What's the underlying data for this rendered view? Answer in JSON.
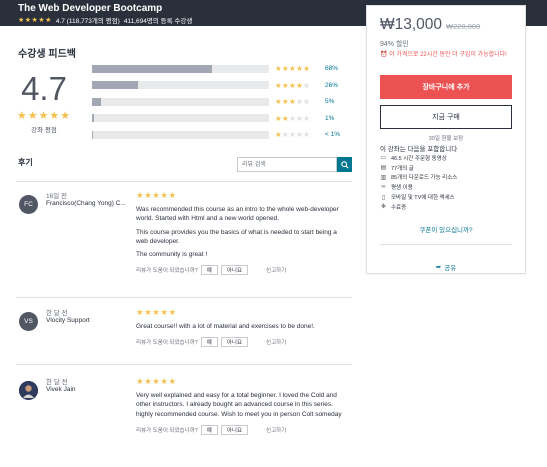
{
  "header": {
    "course_title": "The Web Developer Bootcamp",
    "stars": "★★★★★",
    "rating_text": "4.7 (118,773개의 평점)",
    "students": "411,694명의 등록 수강생"
  },
  "feedback": {
    "title": "수강생 피드백",
    "average": "4.7",
    "average_stars": "★★★★★",
    "average_label": "강좌 평점",
    "distribution": [
      {
        "stars_on": "★★★★★",
        "stars_off": "",
        "percent": 68,
        "label": "68%"
      },
      {
        "stars_on": "★★★★",
        "stars_off": "★",
        "percent": 26,
        "label": "26%"
      },
      {
        "stars_on": "★★★",
        "stars_off": "★★",
        "percent": 5,
        "label": "5%"
      },
      {
        "stars_on": "★★",
        "stars_off": "★★★",
        "percent": 1,
        "label": "1%"
      },
      {
        "stars_on": "★",
        "stars_off": "★★★★",
        "percent": 0.5,
        "label": "< 1%"
      }
    ]
  },
  "reviews": {
    "title": "후기",
    "search_placeholder": "리뷰 검색",
    "helpful_question": "리뷰가 도움이 되었습니까?",
    "yes": "예",
    "no": "아니요",
    "report": "신고하기",
    "items": [
      {
        "initials": "FC",
        "time": "16일 전",
        "name": "Francisco(Chang Yong) C...",
        "stars": "★★★★★",
        "paragraphs": [
          "Was recommended this course as an intro to the whole web-developer world. Started with Html and a new world opened.",
          "This course provides you the basics of what is needed to start being a web developer.",
          "The community is great !"
        ]
      },
      {
        "initials": "VS",
        "time": "한 달 전",
        "name": "Vlocity Support",
        "stars": "★★★★★",
        "paragraphs": [
          "Great course!! with a lot of material and exercises to be done!."
        ]
      },
      {
        "initials": "",
        "time": "한 달 전",
        "name": "Vivek Jain",
        "stars": "★★★★★",
        "paragraphs": [
          "Very well explained and easy for a total beginner. I loved the Cold and other instructors. I already bought an advanced course in this series. highly recommended course. Wish to meet you in person Colt someday"
        ]
      }
    ]
  },
  "sidebar": {
    "price": "₩13,000",
    "original_price": "₩220,000",
    "discount": "94% 할인",
    "deadline": "이 가격으로 22시간 동안 더 구입이 가능합니다!",
    "add_to_cart": "장바구니에 추가",
    "buy_now": "지금 구매",
    "guarantee": "30일 환불 보장",
    "includes_title": "이 강좌는 다음을 포함합니다",
    "includes": [
      {
        "icon": "video-icon",
        "glyph": "▭",
        "text": "46.5 시간 주문형 동영상"
      },
      {
        "icon": "article-icon",
        "glyph": "▤",
        "text": "77개의 글"
      },
      {
        "icon": "resources-icon",
        "glyph": "▥",
        "text": "85개의 다운로드 가능 리소스"
      },
      {
        "icon": "lifetime-icon",
        "glyph": "∞",
        "text": "평생 이용"
      },
      {
        "icon": "mobile-icon",
        "glyph": "▯",
        "text": "모바일 및 TV에 대한 액세스"
      },
      {
        "icon": "certificate-icon",
        "glyph": "✻",
        "text": "수료증"
      }
    ],
    "coupon": "쿠폰이 있으십니까?",
    "share": "공유"
  },
  "colors": {
    "topbar": "#29303b",
    "star": "#f4c150",
    "link": "#007791",
    "cart": "#ec5252"
  }
}
